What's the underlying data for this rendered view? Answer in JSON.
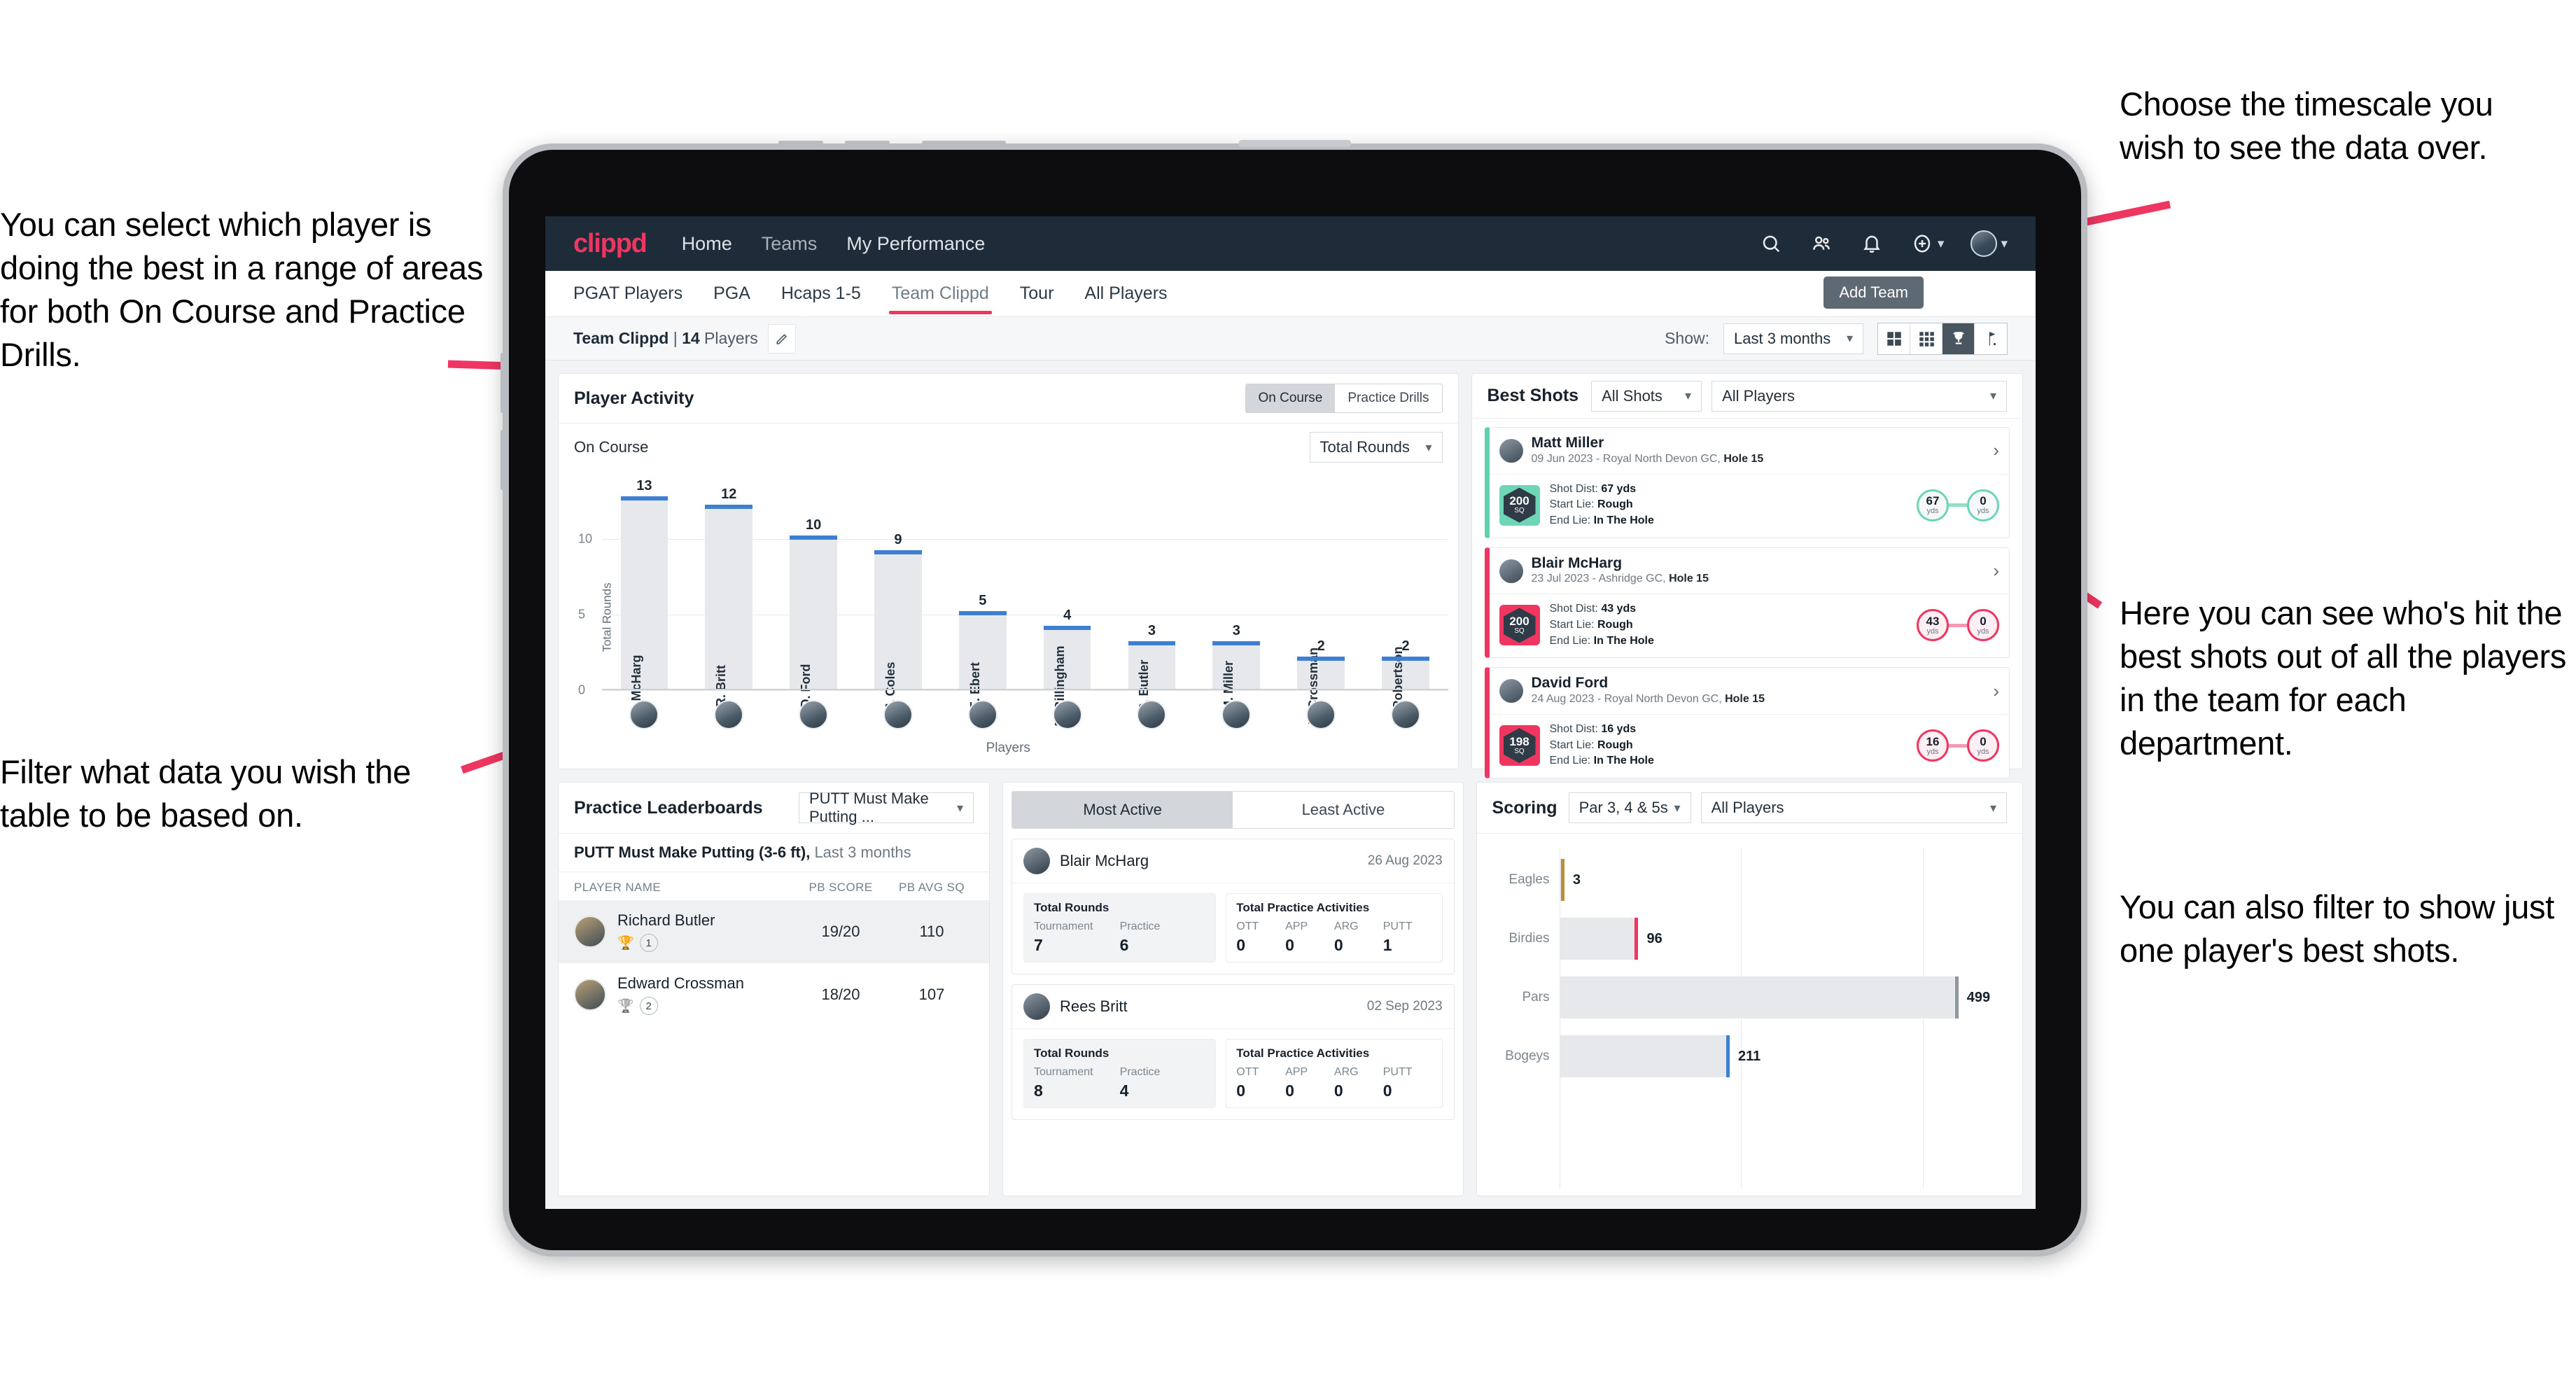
{
  "annotations": {
    "left_top": "You can select which player is doing the best in a range of areas for both On Course and Practice Drills.",
    "left_bottom": "Filter what data you wish the table to be based on.",
    "right_top": "Choose the timescale you wish to see the data over.",
    "right_mid": "Here you can see who's hit the best shots out of all the players in the team for each department.",
    "right_bottom": "You can also filter to show just one player's best shots."
  },
  "navbar": {
    "logo": "clippd",
    "links": [
      {
        "label": "Home"
      },
      {
        "label": "Teams"
      },
      {
        "label": "My Performance"
      }
    ],
    "icons": [
      "search-icon",
      "people-icon",
      "bell-icon",
      "plus-circle-icon"
    ]
  },
  "subtabs": {
    "items": [
      {
        "label": "PGAT Players",
        "active": false
      },
      {
        "label": "PGA",
        "active": false
      },
      {
        "label": "Hcaps 1-5",
        "active": false
      },
      {
        "label": "Team Clippd",
        "active": true
      },
      {
        "label": "Tour",
        "active": false
      },
      {
        "label": "All Players",
        "active": false
      }
    ],
    "tooltip": "Add Team"
  },
  "toolbar": {
    "team_name": "Team Clippd",
    "team_sep": " | ",
    "team_count": "14",
    "team_players_word": " Players",
    "show_label": "Show:",
    "date_value": "Last 3 months",
    "view_icons": [
      "grid-large-icon",
      "grid-small-icon",
      "trophy-icon",
      "flag-icon"
    ],
    "active_view": "trophy-icon"
  },
  "player_activity": {
    "title": "Player Activity",
    "segments": [
      {
        "label": "On Course",
        "active": true
      },
      {
        "label": "Practice Drills",
        "active": false
      }
    ],
    "sub_label": "On Course",
    "metric_value": "Total Rounds",
    "chart_data": {
      "type": "bar",
      "title": "Player Activity",
      "xlabel": "Players",
      "ylabel": "Total Rounds",
      "ylim": [
        0,
        14
      ],
      "yticks": [
        0,
        5,
        10
      ],
      "grid": true,
      "categories": [
        "B. McHarg",
        "R. Britt",
        "D. Ford",
        "J. Coles",
        "E. Ebert",
        "D. Billingham",
        "R. Butler",
        "M. Miller",
        "E. Crossman",
        "C. Robertson"
      ],
      "values": [
        13,
        12,
        10,
        9,
        5,
        4,
        3,
        3,
        2,
        2
      ]
    }
  },
  "best_shots": {
    "title": "Best Shots",
    "filter_shots": "All Shots",
    "filter_players": "All Players",
    "cards": [
      {
        "name": "Matt Miller",
        "meta_prefix": "09 Jun 2023 - Royal North Devon GC, ",
        "meta_hole": "Hole 15",
        "sq": "200",
        "sq_unit": "SQ",
        "accent": "teal",
        "shot_dist_label": "Shot Dist: ",
        "shot_dist": "67 yds",
        "start_lie_label": "Start Lie: ",
        "start_lie": "Rough",
        "end_lie_label": "End Lie: ",
        "end_lie": "In The Hole",
        "from_val": "67",
        "from_unit": "yds",
        "to_val": "0",
        "to_unit": "yds"
      },
      {
        "name": "Blair McHarg",
        "meta_prefix": "23 Jul 2023 - Ashridge GC, ",
        "meta_hole": "Hole 15",
        "sq": "200",
        "sq_unit": "SQ",
        "accent": "pink",
        "shot_dist_label": "Shot Dist: ",
        "shot_dist": "43 yds",
        "start_lie_label": "Start Lie: ",
        "start_lie": "Rough",
        "end_lie_label": "End Lie: ",
        "end_lie": "In The Hole",
        "from_val": "43",
        "from_unit": "yds",
        "to_val": "0",
        "to_unit": "yds"
      },
      {
        "name": "David Ford",
        "meta_prefix": "24 Aug 2023 - Royal North Devon GC, ",
        "meta_hole": "Hole 15",
        "sq": "198",
        "sq_unit": "SQ",
        "accent": "pink",
        "shot_dist_label": "Shot Dist: ",
        "shot_dist": "16 yds",
        "start_lie_label": "Start Lie: ",
        "start_lie": "Rough",
        "end_lie_label": "End Lie: ",
        "end_lie": "In The Hole",
        "from_val": "16",
        "from_unit": "yds",
        "to_val": "0",
        "to_unit": "yds"
      }
    ]
  },
  "practice_leaderboards": {
    "title": "Practice Leaderboards",
    "drill_filter": "PUTT Must Make Putting ...",
    "subtitle_bold": "PUTT Must Make Putting (3-6 ft),",
    "subtitle_rest": " Last 3 months",
    "columns": [
      "PLAYER NAME",
      "PB SCORE",
      "PB AVG SQ"
    ],
    "rows": [
      {
        "name": "Richard Butler",
        "rank": "1",
        "trophy": "gold",
        "score": "19/20",
        "avg_sq": "110",
        "highlight": true
      },
      {
        "name": "Edward Crossman",
        "rank": "2",
        "trophy": "silver",
        "score": "18/20",
        "avg_sq": "107",
        "highlight": false
      }
    ]
  },
  "activity_panel": {
    "tabs": [
      {
        "label": "Most Active",
        "active": true
      },
      {
        "label": "Least Active",
        "active": false
      }
    ],
    "cards": [
      {
        "name": "Blair McHarg",
        "date": "26 Aug 2023",
        "rounds_title": "Total Rounds",
        "rounds": [
          {
            "key": "Tournament",
            "value": "7"
          },
          {
            "key": "Practice",
            "value": "6"
          }
        ],
        "practice_title": "Total Practice Activities",
        "practice": [
          {
            "key": "OTT",
            "value": "0"
          },
          {
            "key": "APP",
            "value": "0"
          },
          {
            "key": "ARG",
            "value": "0"
          },
          {
            "key": "PUTT",
            "value": "1"
          }
        ]
      },
      {
        "name": "Rees Britt",
        "date": "02 Sep 2023",
        "rounds_title": "Total Rounds",
        "rounds": [
          {
            "key": "Tournament",
            "value": "8"
          },
          {
            "key": "Practice",
            "value": "4"
          }
        ],
        "practice_title": "Total Practice Activities",
        "practice": [
          {
            "key": "OTT",
            "value": "0"
          },
          {
            "key": "APP",
            "value": "0"
          },
          {
            "key": "ARG",
            "value": "0"
          },
          {
            "key": "PUTT",
            "value": "0"
          }
        ]
      }
    ]
  },
  "scoring": {
    "title": "Scoring",
    "filter_par": "Par 3, 4 & 5s",
    "filter_players": "All Players",
    "chart_data": {
      "type": "bar",
      "orientation": "horizontal",
      "title": "Scoring",
      "categories": [
        "Eagles",
        "Birdies",
        "Pars",
        "Bogeys"
      ],
      "values": [
        3,
        96,
        499,
        211
      ],
      "colors": [
        "#b9903c",
        "#ee3661",
        "#8e999f",
        "#3d7fd1"
      ],
      "xlim": [
        0,
        560
      ],
      "grid": true
    }
  },
  "colors": {
    "brand_pink": "#ee3661",
    "navbar_dark": "#1e2b38",
    "bar_blue": "#3d7fd1",
    "teal": "#6ed6b6",
    "page_bg": "#f1f3f5"
  }
}
